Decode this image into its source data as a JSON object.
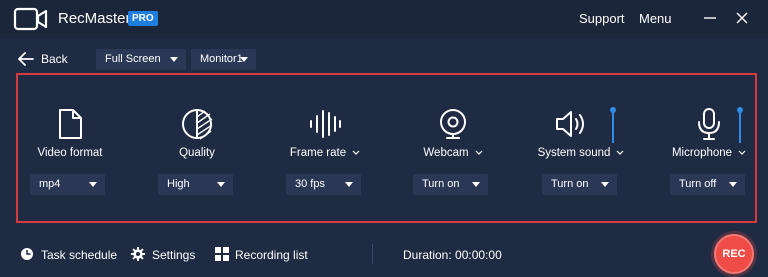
{
  "app": {
    "name": "RecMaster",
    "badge": "PRO"
  },
  "header": {
    "support": "Support",
    "menu": "Menu"
  },
  "toolbar": {
    "back": "Back",
    "mode": "Full Screen",
    "monitor": "Monitor1"
  },
  "settings": [
    {
      "label": "Video format",
      "value": "mp4",
      "icon": "document-icon"
    },
    {
      "label": "Quality",
      "value": "High",
      "icon": "quality-icon"
    },
    {
      "label": "Frame rate",
      "value": "30 fps",
      "icon": "frame-rate-icon"
    },
    {
      "label": "Webcam",
      "value": "Turn on",
      "icon": "webcam-icon"
    },
    {
      "label": "System sound",
      "value": "Turn on",
      "icon": "speaker-icon",
      "volume_level": 1.0
    },
    {
      "label": "Microphone",
      "value": "Turn off",
      "icon": "microphone-icon",
      "volume_level": 1.0
    }
  ],
  "footer": {
    "task_schedule": "Task schedule",
    "settings": "Settings",
    "recording_list": "Recording list",
    "duration": "Duration: 00:00:00",
    "rec": "REC"
  },
  "colors": {
    "background": "#1f2b42",
    "accent": "#1e7fe0",
    "highlight_border": "#d53b3e",
    "record": "#ef4b47"
  }
}
